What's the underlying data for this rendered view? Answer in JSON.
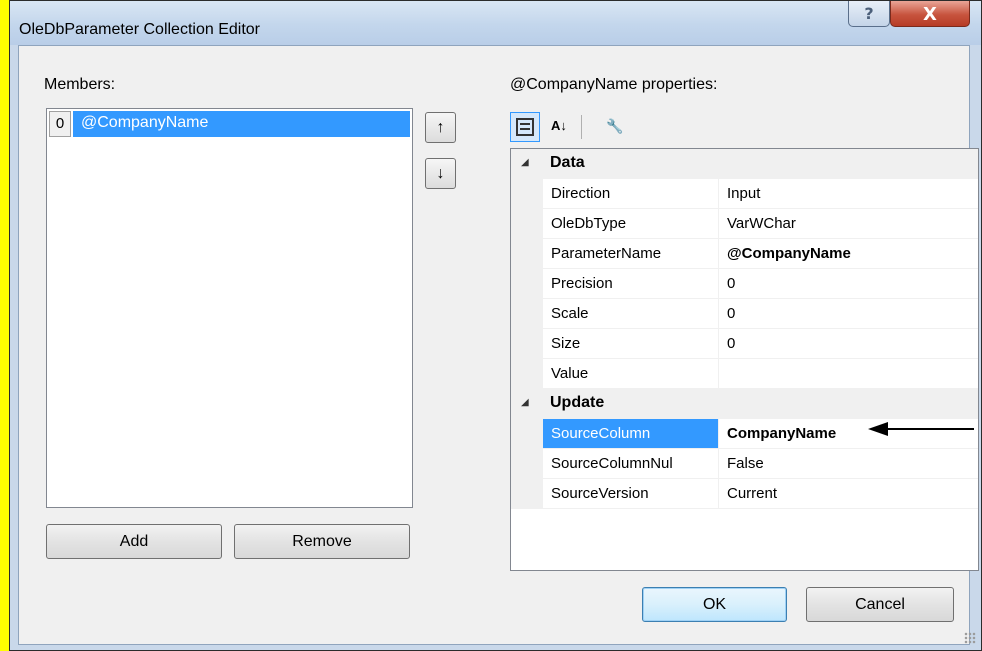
{
  "window": {
    "title": "OleDbParameter Collection Editor",
    "help_glyph": "?",
    "close_glyph": "X"
  },
  "members": {
    "label": "Members:",
    "items": [
      {
        "index": "0",
        "name": "@CompanyName",
        "selected": true
      }
    ],
    "move_up_glyph": "↑",
    "move_down_glyph": "↓",
    "add_label": "Add",
    "remove_label": "Remove"
  },
  "properties": {
    "label": "@CompanyName properties:",
    "toolbar": {
      "categorized_icon": "categorized-icon",
      "alphabetical_icon": "sort-alphabetical-icon",
      "alphabetical_glyph": "A↓",
      "property_pages_icon": "wrench-icon",
      "property_pages_glyph": "🔧"
    },
    "categories": [
      {
        "name": "Data",
        "toggle_glyph": "◢",
        "rows": [
          {
            "name": "Direction",
            "value": "Input",
            "bold": false
          },
          {
            "name": "OleDbType",
            "value": "VarWChar",
            "bold": false
          },
          {
            "name": "ParameterName",
            "value": "@CompanyName",
            "bold": true
          },
          {
            "name": "Precision",
            "value": "0",
            "bold": false
          },
          {
            "name": "Scale",
            "value": "0",
            "bold": false
          },
          {
            "name": "Size",
            "value": "0",
            "bold": false
          },
          {
            "name": "Value",
            "value": "",
            "bold": false
          }
        ]
      },
      {
        "name": "Update",
        "toggle_glyph": "◢",
        "rows": [
          {
            "name": "SourceColumn",
            "value": "CompanyName",
            "bold": true,
            "selected": true
          },
          {
            "name": "SourceColumnNul",
            "value": "False",
            "bold": false
          },
          {
            "name": "SourceVersion",
            "value": "Current",
            "bold": false
          }
        ]
      }
    ]
  },
  "buttons": {
    "ok_label": "OK",
    "cancel_label": "Cancel"
  },
  "colors": {
    "selection": "#3399ff",
    "highlight_background": "#ffff00"
  }
}
